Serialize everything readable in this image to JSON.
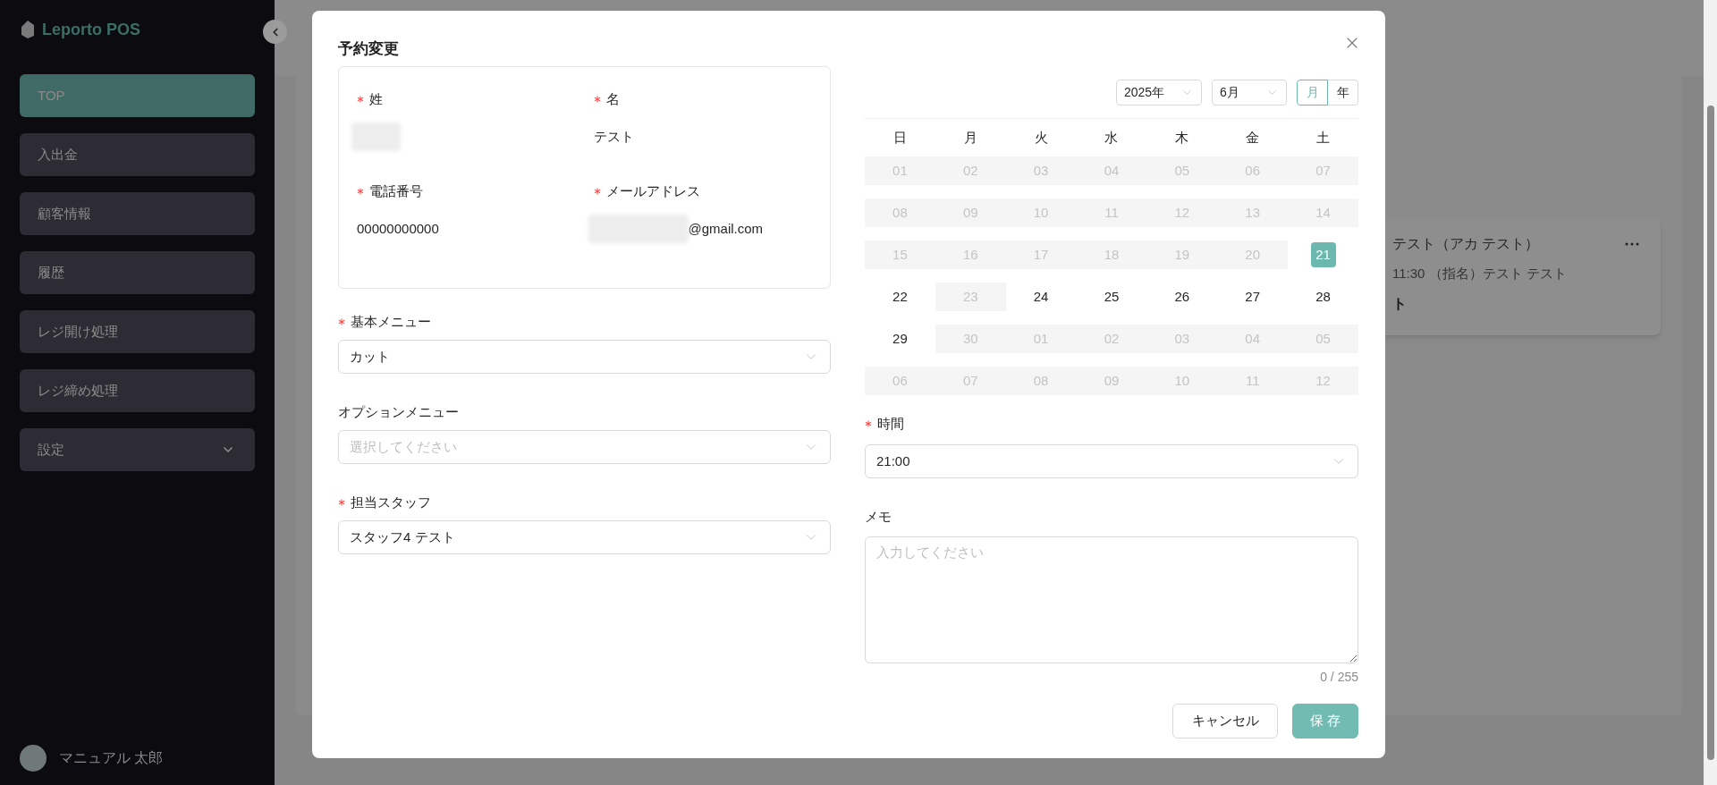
{
  "sidebar": {
    "logo": "Leporto POS",
    "items": [
      {
        "label": "TOP",
        "selected": true,
        "kind": "link"
      },
      {
        "label": "入出金",
        "selected": false,
        "kind": "link"
      },
      {
        "label": "顧客情報",
        "selected": false,
        "kind": "link"
      },
      {
        "label": "履歴",
        "selected": false,
        "kind": "link"
      },
      {
        "label": "レジ開け処理",
        "selected": false,
        "kind": "link"
      },
      {
        "label": "レジ締め処理",
        "selected": false,
        "kind": "link"
      },
      {
        "label": "設定",
        "selected": false,
        "kind": "group"
      }
    ],
    "user": {
      "name": "マニュアル 太郎"
    }
  },
  "background": {
    "card": {
      "title": "テスト（アカ テスト）",
      "detail": "11:30 （指名）テスト テスト",
      "menu": "ト"
    }
  },
  "dialog": {
    "title": "予約変更",
    "customer": [
      {
        "label": "姓",
        "required": true,
        "redacted": true
      },
      {
        "label": "名",
        "required": true,
        "redacted": false,
        "value": "テスト"
      },
      {
        "label": "電話番号",
        "required": true,
        "redacted": false,
        "value": "00000000000"
      },
      {
        "label": "メールアドレス",
        "required": true,
        "redacted": true,
        "value": "@gmail.com"
      }
    ],
    "fields": [
      {
        "label": "基本メニュー",
        "required": true,
        "value": "カット"
      },
      {
        "label": "オプションメニュー",
        "required": false,
        "placeholder": "選択してください"
      },
      {
        "label": "担当スタッフ",
        "required": true,
        "value": "スタッフ4 テスト"
      }
    ],
    "calendar": {
      "year": "2025年",
      "month": "6月",
      "modes": [
        {
          "label": "月",
          "selected": true
        },
        {
          "label": "年",
          "selected": false
        }
      ],
      "weekdays": [
        "日",
        "月",
        "火",
        "水",
        "木",
        "金",
        "土"
      ],
      "weeks": [
        [
          {
            "day": "01",
            "disabled": true,
            "selected": false
          },
          {
            "day": "02",
            "disabled": true,
            "selected": false
          },
          {
            "day": "03",
            "disabled": true,
            "selected": false
          },
          {
            "day": "04",
            "disabled": true,
            "selected": false
          },
          {
            "day": "05",
            "disabled": true,
            "selected": false
          },
          {
            "day": "06",
            "disabled": true,
            "selected": false
          },
          {
            "day": "07",
            "disabled": true,
            "selected": false
          }
        ],
        [
          {
            "day": "08",
            "disabled": true,
            "selected": false
          },
          {
            "day": "09",
            "disabled": true,
            "selected": false
          },
          {
            "day": "10",
            "disabled": true,
            "selected": false
          },
          {
            "day": "11",
            "disabled": true,
            "selected": false
          },
          {
            "day": "12",
            "disabled": true,
            "selected": false
          },
          {
            "day": "13",
            "disabled": true,
            "selected": false
          },
          {
            "day": "14",
            "disabled": true,
            "selected": false
          }
        ],
        [
          {
            "day": "15",
            "disabled": true,
            "selected": false
          },
          {
            "day": "16",
            "disabled": true,
            "selected": false
          },
          {
            "day": "17",
            "disabled": true,
            "selected": false
          },
          {
            "day": "18",
            "disabled": true,
            "selected": false
          },
          {
            "day": "19",
            "disabled": true,
            "selected": false
          },
          {
            "day": "20",
            "disabled": true,
            "selected": false
          },
          {
            "day": "21",
            "disabled": false,
            "selected": true
          }
        ],
        [
          {
            "day": "22",
            "disabled": false,
            "selected": false
          },
          {
            "day": "23",
            "disabled": true,
            "selected": false
          },
          {
            "day": "24",
            "disabled": false,
            "selected": false
          },
          {
            "day": "25",
            "disabled": false,
            "selected": false
          },
          {
            "day": "26",
            "disabled": false,
            "selected": false
          },
          {
            "day": "27",
            "disabled": false,
            "selected": false
          },
          {
            "day": "28",
            "disabled": false,
            "selected": false
          }
        ],
        [
          {
            "day": "29",
            "disabled": false,
            "selected": false
          },
          {
            "day": "30",
            "disabled": true,
            "selected": false
          },
          {
            "day": "01",
            "disabled": true,
            "selected": false
          },
          {
            "day": "02",
            "disabled": true,
            "selected": false
          },
          {
            "day": "03",
            "disabled": true,
            "selected": false
          },
          {
            "day": "04",
            "disabled": true,
            "selected": false
          },
          {
            "day": "05",
            "disabled": true,
            "selected": false
          }
        ],
        [
          {
            "day": "06",
            "disabled": true,
            "selected": false
          },
          {
            "day": "07",
            "disabled": true,
            "selected": false
          },
          {
            "day": "08",
            "disabled": true,
            "selected": false
          },
          {
            "day": "09",
            "disabled": true,
            "selected": false
          },
          {
            "day": "10",
            "disabled": true,
            "selected": false
          },
          {
            "day": "11",
            "disabled": true,
            "selected": false
          },
          {
            "day": "12",
            "disabled": true,
            "selected": false
          }
        ]
      ]
    },
    "time": {
      "label": "時間",
      "required": true,
      "value": "21:00"
    },
    "memo": {
      "label": "メモ",
      "required": false,
      "placeholder": "入力してください",
      "counter": "0 / 255"
    },
    "buttons": [
      {
        "label": "キャンセル",
        "kind": "default"
      },
      {
        "label": "保 存",
        "kind": "primary"
      }
    ]
  }
}
